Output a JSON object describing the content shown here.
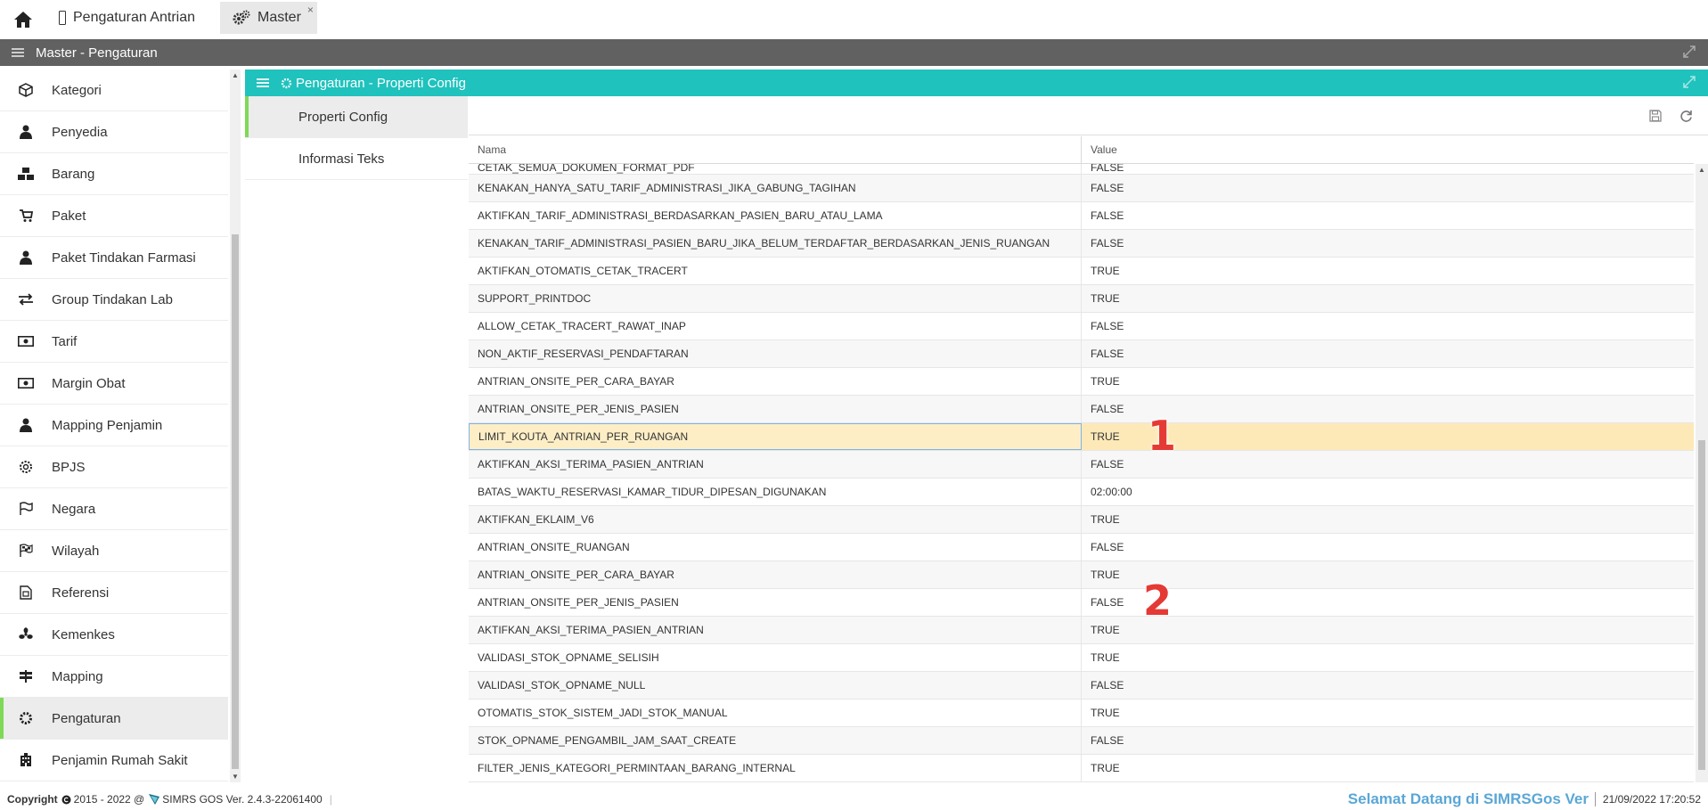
{
  "top_tabs": [
    {
      "label": "Pengaturan Antrian",
      "icon": "mobile-icon"
    },
    {
      "label": "Master",
      "icon": "gears-icon",
      "close": "×"
    }
  ],
  "title_bar": {
    "title": "Master - Pengaturan"
  },
  "sidebar": {
    "items": [
      {
        "label": "Kategori",
        "icon": "cube-icon"
      },
      {
        "label": "Penyedia",
        "icon": "user-icon"
      },
      {
        "label": "Barang",
        "icon": "cubes-icon"
      },
      {
        "label": "Paket",
        "icon": "cart-icon"
      },
      {
        "label": "Paket Tindakan Farmasi",
        "icon": "user-icon"
      },
      {
        "label": "Group Tindakan Lab",
        "icon": "exchange-icon"
      },
      {
        "label": "Tarif",
        "icon": "money-icon"
      },
      {
        "label": "Margin Obat",
        "icon": "money-icon"
      },
      {
        "label": "Mapping Penjamin",
        "icon": "user-icon"
      },
      {
        "label": "BPJS",
        "icon": "gear-outline-icon"
      },
      {
        "label": "Negara",
        "icon": "flag-outline-icon"
      },
      {
        "label": "Wilayah",
        "icon": "flag-checkered-icon"
      },
      {
        "label": "Referensi",
        "icon": "file-icon"
      },
      {
        "label": "Kemenkes",
        "icon": "fan-icon"
      },
      {
        "label": "Mapping",
        "icon": "signs-icon"
      },
      {
        "label": "Pengaturan",
        "icon": "gear-icon",
        "active": true
      },
      {
        "label": "Penjamin Rumah Sakit",
        "icon": "building-icon"
      }
    ]
  },
  "panel": {
    "title": "Pengaturan - Properti Config"
  },
  "subnav": {
    "items": [
      {
        "label": "Properti Config",
        "active": true
      },
      {
        "label": "Informasi Teks"
      }
    ]
  },
  "grid": {
    "columns": {
      "name": "Nama",
      "value": "Value"
    },
    "rows": [
      {
        "name": "CETAK_SEMUA_DOKUMEN_FORMAT_PDF",
        "value": "FALSE"
      },
      {
        "name": "KENAKAN_HANYA_SATU_TARIF_ADMINISTRASI_JIKA_GABUNG_TAGIHAN",
        "value": "FALSE"
      },
      {
        "name": "AKTIFKAN_TARIF_ADMINISTRASI_BERDASARKAN_PASIEN_BARU_ATAU_LAMA",
        "value": "FALSE"
      },
      {
        "name": "KENAKAN_TARIF_ADMINISTRASI_PASIEN_BARU_JIKA_BELUM_TERDAFTAR_BERDASARKAN_JENIS_RUANGAN",
        "value": "FALSE"
      },
      {
        "name": "AKTIFKAN_OTOMATIS_CETAK_TRACERT",
        "value": "TRUE"
      },
      {
        "name": "SUPPORT_PRINTDOC",
        "value": "TRUE"
      },
      {
        "name": "ALLOW_CETAK_TRACERT_RAWAT_INAP",
        "value": "FALSE"
      },
      {
        "name": "NON_AKTIF_RESERVASI_PENDAFTARAN",
        "value": "FALSE"
      },
      {
        "name": "ANTRIAN_ONSITE_PER_CARA_BAYAR",
        "value": "TRUE"
      },
      {
        "name": "ANTRIAN_ONSITE_PER_JENIS_PASIEN",
        "value": "FALSE"
      },
      {
        "name": "LIMIT_KOUTA_ANTRIAN_PER_RUANGAN",
        "value": "TRUE",
        "selected": true
      },
      {
        "name": "AKTIFKAN_AKSI_TERIMA_PASIEN_ANTRIAN",
        "value": "FALSE"
      },
      {
        "name": "BATAS_WAKTU_RESERVASI_KAMAR_TIDUR_DIPESAN_DIGUNAKAN",
        "value": "02:00:00"
      },
      {
        "name": "AKTIFKAN_EKLAIM_V6",
        "value": "TRUE"
      },
      {
        "name": "ANTRIAN_ONSITE_RUANGAN",
        "value": "FALSE"
      },
      {
        "name": "ANTRIAN_ONSITE_PER_CARA_BAYAR",
        "value": "TRUE"
      },
      {
        "name": "ANTRIAN_ONSITE_PER_JENIS_PASIEN",
        "value": "FALSE"
      },
      {
        "name": "AKTIFKAN_AKSI_TERIMA_PASIEN_ANTRIAN",
        "value": "TRUE"
      },
      {
        "name": "VALIDASI_STOK_OPNAME_SELISIH",
        "value": "TRUE"
      },
      {
        "name": "VALIDASI_STOK_OPNAME_NULL",
        "value": "FALSE"
      },
      {
        "name": "OTOMATIS_STOK_SISTEM_JADI_STOK_MANUAL",
        "value": "TRUE"
      },
      {
        "name": "STOK_OPNAME_PENGAMBIL_JAM_SAAT_CREATE",
        "value": "FALSE"
      },
      {
        "name": "FILTER_JENIS_KATEGORI_PERMINTAAN_BARANG_INTERNAL",
        "value": "TRUE"
      }
    ]
  },
  "annotations": [
    "1",
    "2"
  ],
  "footer": {
    "copyright": "Copyright",
    "years": "2015 - 2022 @",
    "product": "SIMRS GOS Ver. 2.4.3-22061400",
    "welcome": "Selamat Datang di SIMRSGos Ver",
    "datetime": "21/09/2022 17:20:52"
  },
  "colors": {
    "accent": "#1fc2bd",
    "titlebar": "#616161",
    "selected_row": "#fde9b8",
    "active_marker": "#7ed957",
    "welcome": "#5aa7d6",
    "annotation": "#e53935"
  }
}
